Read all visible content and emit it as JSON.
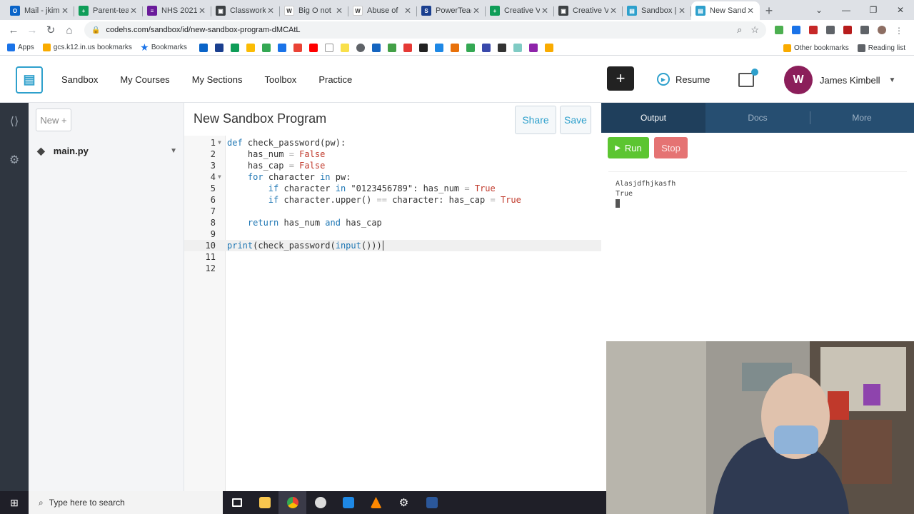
{
  "browser": {
    "tabs": [
      {
        "title": "Mail - jkim",
        "color": "#0a64c8",
        "glyph": "O"
      },
      {
        "title": "Parent-tea",
        "color": "#0f9d58",
        "glyph": "+"
      },
      {
        "title": "NHS 2021",
        "color": "#6a1b9a",
        "glyph": "≡"
      },
      {
        "title": "Classwork",
        "color": "#3c4043",
        "glyph": "▣"
      },
      {
        "title": "Big O not",
        "color": "#ffffff",
        "glyph": "W"
      },
      {
        "title": "Abuse of",
        "color": "#ffffff",
        "glyph": "W"
      },
      {
        "title": "PowerTeac",
        "color": "#1a3f8f",
        "glyph": "S"
      },
      {
        "title": "Creative V",
        "color": "#0f9d58",
        "glyph": "+"
      },
      {
        "title": "Creative V",
        "color": "#3c4043",
        "glyph": "▣"
      },
      {
        "title": "Sandbox |",
        "color": "#2ea0cc",
        "glyph": "▤"
      },
      {
        "title": "New Sand",
        "color": "#2ea0cc",
        "glyph": "▤"
      }
    ],
    "url": "codehs.com/sandbox/id/new-sandbox-program-dMCAtL",
    "bookmarks": {
      "apps": "Apps",
      "gcs": "gcs.k12.in.us bookmarks",
      "bookmarks": "Bookmarks",
      "other": "Other bookmarks",
      "reading": "Reading list"
    }
  },
  "header": {
    "nav": [
      "Sandbox",
      "My Courses",
      "My Sections",
      "Toolbox",
      "Practice"
    ],
    "resume": "Resume",
    "user_name": "James Kimbell"
  },
  "files": {
    "new_label": "New +",
    "items": [
      "main.py"
    ]
  },
  "editor": {
    "title": "New Sandbox Program",
    "share": "Share",
    "save": "Save",
    "line_numbers": [
      "1",
      "2",
      "3",
      "4",
      "5",
      "6",
      "7",
      "8",
      "9",
      "10",
      "11",
      "12"
    ],
    "active_line": 10
  },
  "output": {
    "tabs": [
      "Output",
      "Docs",
      "More"
    ],
    "run": "Run",
    "stop": "Stop",
    "console": [
      "Alasjdfhjkasfh",
      "True"
    ]
  },
  "taskbar": {
    "search": "Type here to search"
  }
}
